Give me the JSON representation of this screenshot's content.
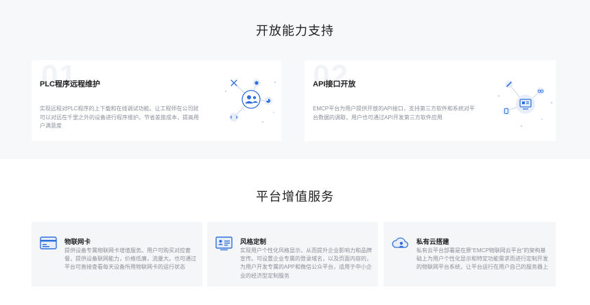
{
  "open_capability": {
    "title": "开放能力支持",
    "cards": [
      {
        "number": "01",
        "title": "PLC程序远程维护",
        "desc": "实现远程对PLC程序的上下载和在线调试功能。让工程师在公司就可以对远在千里之外的设备进行程序维护。节省差旅成本，提高用户满意度",
        "icons": [
          "tools-icon",
          "link-icon",
          "users-icon",
          "chart-icon",
          "code-icon"
        ]
      },
      {
        "number": "02",
        "title": "API接口开放",
        "desc": "EMCP平台为用户提供开放的API接口，支持第三方软件和系统对平台数据的调取，用户也可通过API开发第三方软件应用",
        "icons": [
          "pen-icon",
          "link-icon",
          "monitor-icon",
          "mobile-icon"
        ]
      }
    ]
  },
  "value_added": {
    "title": "平台增值服务",
    "cards": [
      {
        "title": "物联网卡",
        "desc": "提供设备专属物联网卡增值服务。用户可购买对应套餐，提供设备联网能力，价格低廉，流量大。也可通过平台可直接查看每天设备所用物联网卡的运行状态",
        "icon": "sim-card-icon"
      },
      {
        "title": "风格定制",
        "desc": "实现用户个性化风格显示，从而提升企业影响力和品牌宣传。可设置企业专属的登录域名，以及页面内容的，为用户开发专属的APP和微信公众平台，适用于中小企业的经济型定制服务",
        "icon": "id-card-icon"
      },
      {
        "title": "私有云搭建",
        "desc": "私有云平台部署是在原“EMCP物联网云平台”的架构基础上为用户个性化显示和特定功能需求而进行定制开发的物联网平台系统，让平台运行在用户自己的服务器上",
        "icon": "cloud-user-icon"
      }
    ]
  },
  "colors": {
    "accent": "#2d6fdc",
    "icon_bg": "#e8eef9",
    "section_bg": "#f7f8fa",
    "card_bg": "#f5f6f8"
  }
}
